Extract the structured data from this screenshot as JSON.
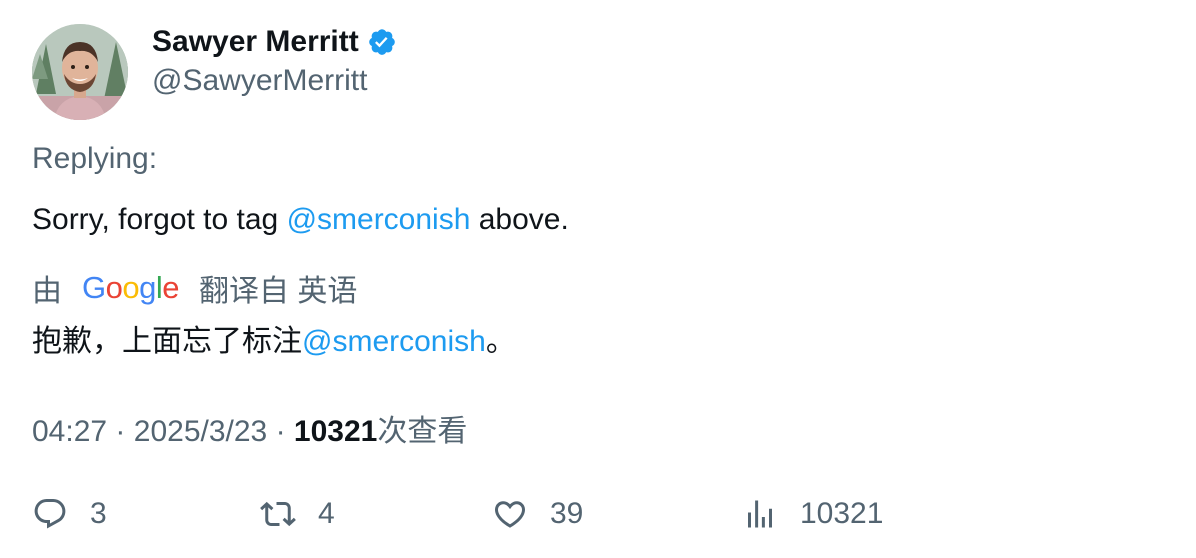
{
  "author": {
    "display_name": "Sawyer Merritt",
    "handle": "@SawyerMerritt",
    "verified": true,
    "verified_color": "#1d9bf0"
  },
  "reply": {
    "label": "Replying:"
  },
  "tweet": {
    "text_before": "Sorry, forgot to tag ",
    "mention": "@smerconish",
    "text_after": " above."
  },
  "translation": {
    "prefix": "由",
    "provider": "Google",
    "suffix": "翻译自 英语",
    "text_before": "抱歉，上面忘了标注",
    "mention": "@smerconish",
    "text_after": "。"
  },
  "meta": {
    "time": "04:27",
    "separator": "·",
    "date": "2025/3/23",
    "views_count": "10321",
    "views_label": "次查看"
  },
  "actions": {
    "replies": "3",
    "retweets": "4",
    "likes": "39",
    "views": "10321"
  },
  "colors": {
    "accent": "#1d9bf0",
    "secondary_text": "#536471",
    "primary_text": "#0f1419"
  }
}
